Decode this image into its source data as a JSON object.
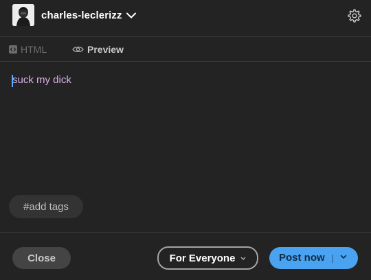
{
  "header": {
    "blog_name": "charles-leclerizz",
    "avatar_icon": "user-avatar",
    "dropdown_icon": "chevron-down-icon",
    "settings_icon": "gear-icon"
  },
  "tabs": [
    {
      "label": "HTML",
      "icon": "html-code-icon",
      "active": false
    },
    {
      "label": "Preview",
      "icon": "eye-icon",
      "active": true
    }
  ],
  "editor": {
    "text": "suck my dick",
    "text_color": "#d9b1ea"
  },
  "tags": {
    "placeholder": "#add tags"
  },
  "footer": {
    "close_label": "Close",
    "audience_label": "For Everyone",
    "post_label": "Post now"
  },
  "colors": {
    "background": "#232323",
    "accent": "#4aa3f0",
    "divider": "#3a3a3a"
  }
}
